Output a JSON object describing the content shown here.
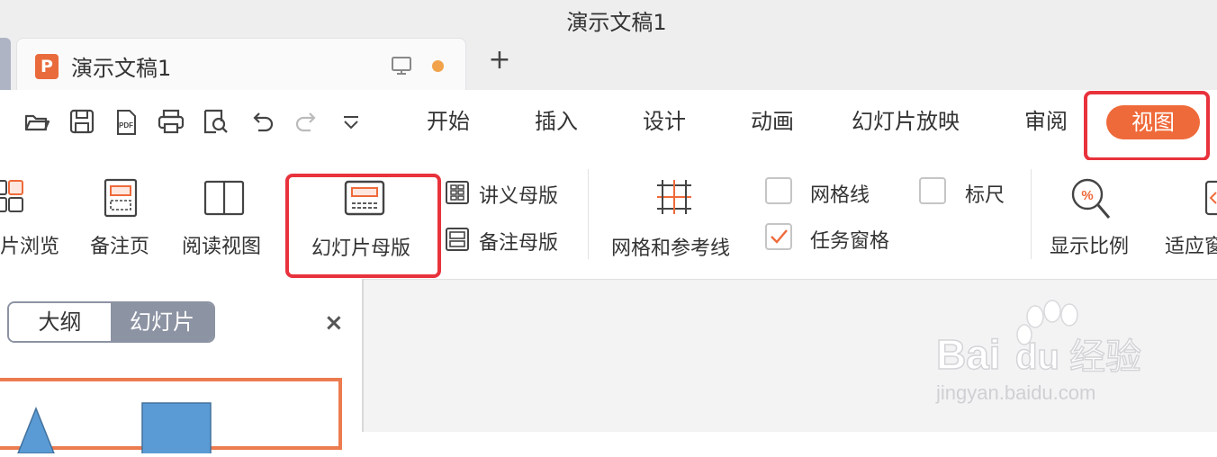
{
  "window": {
    "title": "演示文稿1"
  },
  "tab": {
    "label": "演示文稿1",
    "icon_letter": "P",
    "new_tab_symbol": "+"
  },
  "menu": {
    "items": [
      "开始",
      "插入",
      "设计",
      "动画",
      "幻灯片放映",
      "审阅"
    ],
    "active": "视图"
  },
  "ribbon": {
    "slide_browse": "片浏览",
    "notes_page": "备注页",
    "reading_view": "阅读视图",
    "slide_master": "幻灯片母版",
    "handout_master": "讲义母版",
    "notes_master": "备注母版",
    "grid_guides": "网格和参考线",
    "gridlines": "网格线",
    "ruler": "标尺",
    "task_pane": "任务窗格",
    "zoom": "显示比例",
    "fit": "适应窗",
    "gridlines_checked": false,
    "ruler_checked": false,
    "task_pane_checked": true
  },
  "panel": {
    "outline_tab": "大纲",
    "slides_tab": "幻灯片",
    "close": "×"
  },
  "watermark": {
    "brand": "Baidu",
    "brand_cn": "经验",
    "url": "jingyan.baidu.com"
  },
  "colors": {
    "accent": "#ef6a3a",
    "highlight": "#e8323c",
    "segment": "#8c93a3"
  }
}
